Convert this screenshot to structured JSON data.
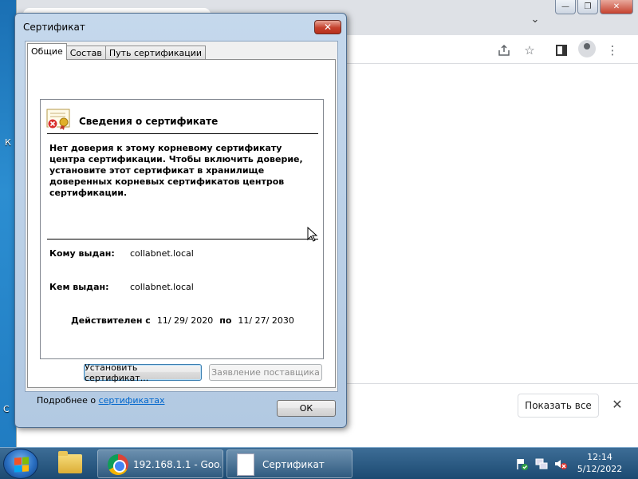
{
  "desktop": {
    "edge_text_1": "К",
    "edge_text_2": "С"
  },
  "browser": {
    "window_buttons": {
      "minimize": "—",
      "maximize": "❐",
      "close": "✕"
    },
    "downloads": {
      "show_all": "Показать все",
      "close": "✕"
    }
  },
  "dialog": {
    "title": "Сертификат",
    "close_glyph": "✕",
    "tabs": [
      {
        "label": "Общие",
        "active": true
      },
      {
        "label": "Состав",
        "active": false
      },
      {
        "label": "Путь сертификации",
        "active": false
      }
    ],
    "info": {
      "heading": "Сведения о сертификате",
      "message": "Нет доверия к этому корневому сертификату центра сертификации. Чтобы включить доверие, установите этот сертификат в хранилище доверенных корневых сертификатов центров сертификации.",
      "issued_to_label": "Кому выдан:",
      "issued_to_value": "collabnet.local",
      "issued_by_label": "Кем выдан:",
      "issued_by_value": "collabnet.local",
      "valid_from_label": "Действителен с",
      "valid_from": "11/ 29/ 2020",
      "valid_to_label": "по",
      "valid_to": "11/ 27/ 2030"
    },
    "buttons": {
      "install": "Установить сертификат...",
      "issuer_statement": "Заявление поставщика",
      "ok": "ОК"
    },
    "more": {
      "prefix": "Подробнее о ",
      "link": "сертификатах"
    }
  },
  "taskbar": {
    "items": [
      {
        "label": ""
      },
      {
        "label": "192.168.1.1 - Goo..."
      },
      {
        "label": "Сертификат"
      }
    ],
    "clock": {
      "time": "12:14",
      "date": "5/12/2022"
    }
  }
}
